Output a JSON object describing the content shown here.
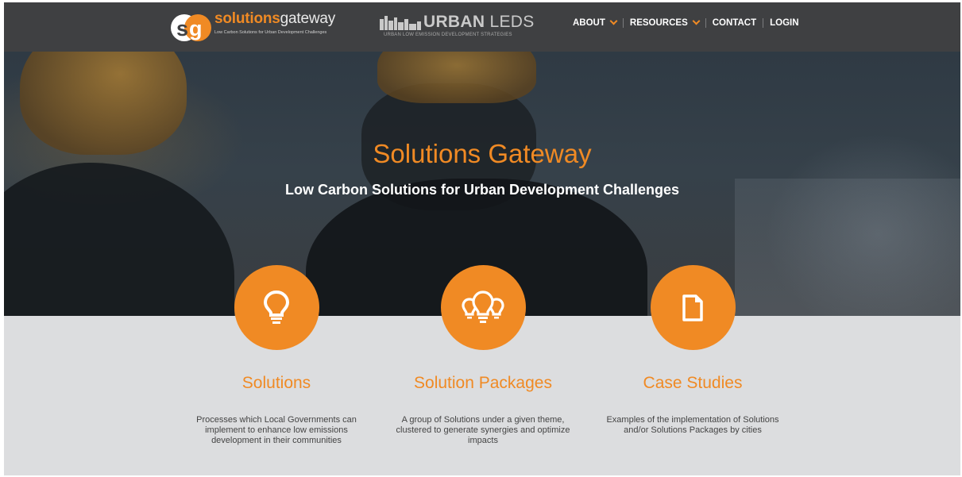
{
  "header": {
    "logo": {
      "mark": "sg",
      "name_accent": "solutions",
      "name_rest": "gateway",
      "tagline": "Low Carbon Solutions for Urban Development Challenges"
    },
    "partner": {
      "title_bold": "URBAN",
      "title_light": " LEDS",
      "subtitle": "URBAN LOW EMISSION DEVELOPMENT STRATEGIES"
    },
    "nav": [
      {
        "label": "ABOUT",
        "dropdown": true
      },
      {
        "label": "RESOURCES",
        "dropdown": true
      },
      {
        "label": "CONTACT",
        "dropdown": false
      },
      {
        "label": "LOGIN",
        "dropdown": false
      }
    ]
  },
  "hero": {
    "title": "Solutions Gateway",
    "subtitle": "Low Carbon Solutions for Urban Development Challenges"
  },
  "features": [
    {
      "icon": "lightbulb-icon",
      "title": "Solutions",
      "description": "Processes which Local Governments can implement to enhance low emissions development in their communities"
    },
    {
      "icon": "lightbulbs-icon",
      "title": "Solution Packages",
      "description": "A group of Solutions under a given theme, clustered to generate synergies and optimize impacts"
    },
    {
      "icon": "document-icon",
      "title": "Case Studies",
      "description": "Examples of the implementation of Solutions and/or Solutions Packages by cities"
    }
  ],
  "colors": {
    "accent": "#f08a24",
    "header_bg": "#3f4042",
    "panel_bg": "#dcdddf"
  }
}
